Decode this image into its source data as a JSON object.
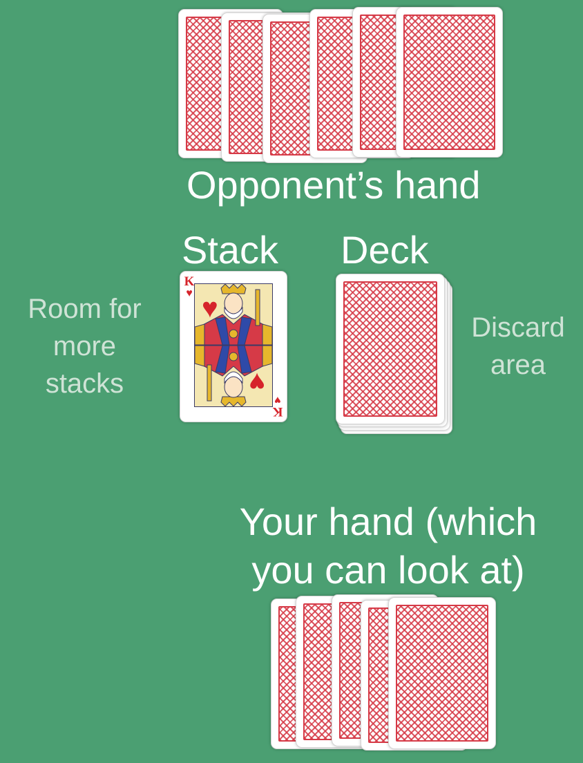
{
  "labels": {
    "opponents_hand": "Opponent’s hand",
    "stack": "Stack",
    "deck": "Deck",
    "room_for_more_stacks": [
      "Room for",
      "more",
      "stacks"
    ],
    "discard_area": [
      "Discard",
      "area"
    ],
    "your_hand": [
      "Your hand (which",
      "you can look at)"
    ]
  },
  "stack_card": {
    "rank": "K",
    "suit_glyph": "♥",
    "suit": "hearts"
  },
  "colors": {
    "table": "#4b9f72",
    "card_back_pattern": "#d63a47",
    "soft_label": "#cfe3d6",
    "heart_red": "#d6242b"
  },
  "counts": {
    "opponent_hand_cards": 6,
    "your_hand_cards": 5
  }
}
